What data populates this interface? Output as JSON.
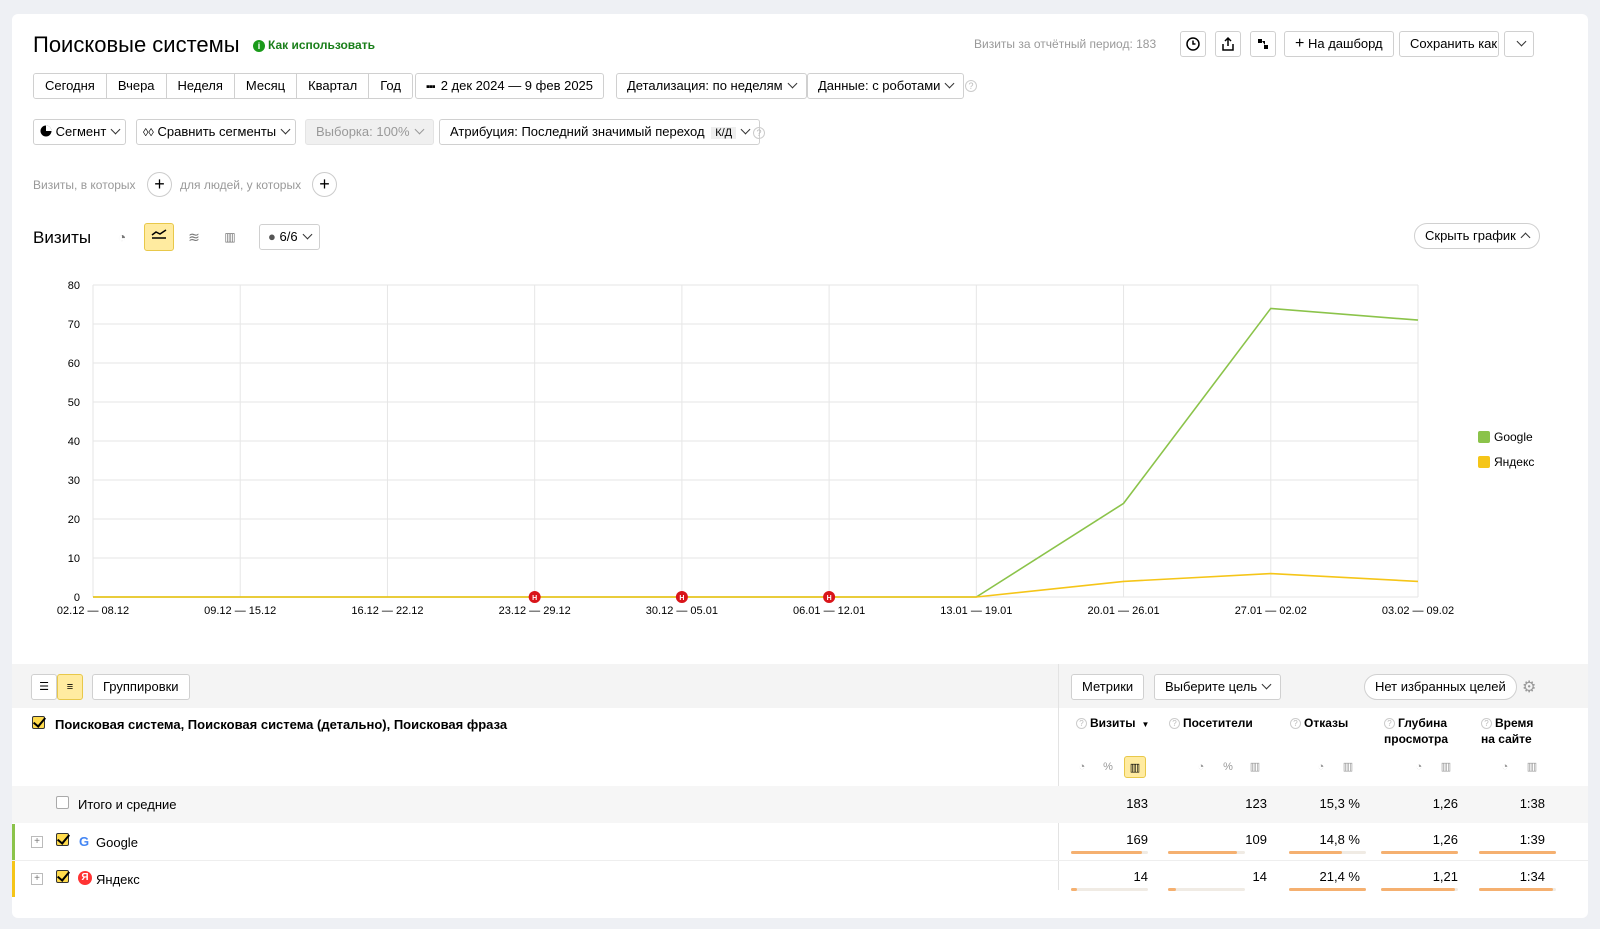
{
  "header": {
    "title": "Поисковые системы",
    "how_to_use": "Как использовать",
    "visits_period": "Визиты за отчётный период: 183",
    "to_dashboard": "На дашборд",
    "save_as": "Сохранить как"
  },
  "period": {
    "presets": [
      "Сегодня",
      "Вчера",
      "Неделя",
      "Месяц",
      "Квартал",
      "Год"
    ],
    "date_range": "2 дек 2024 — 9 фев 2025",
    "detail": "Детализация: по неделям",
    "data": "Данные: с роботами"
  },
  "filters": {
    "segment": "Сегмент",
    "compare": "Сравнить сегменты",
    "sample": "Выборка: 100%",
    "attribution": "Атрибуция: Последний значимый переход",
    "attribution_badge": "К/Д",
    "visits_where": "Визиты, в которых",
    "people_where": "для людей, у которых"
  },
  "chart_panel": {
    "title": "Визиты",
    "series_count": "6/6",
    "hide_chart": "Скрыть график"
  },
  "chart_data": {
    "type": "line",
    "categories": [
      "02.12 — 08.12",
      "09.12 — 15.12",
      "16.12 — 22.12",
      "23.12 — 29.12",
      "30.12 — 05.01",
      "06.01 — 12.01",
      "13.01 — 19.01",
      "20.01 — 26.01",
      "27.01 — 02.02",
      "03.02 — 09.02"
    ],
    "y_ticks": [
      0,
      10,
      20,
      30,
      40,
      50,
      60,
      70,
      80
    ],
    "ylim": [
      0,
      80
    ],
    "series": [
      {
        "name": "Google",
        "color": "#8bc34a",
        "values": [
          0,
          0,
          0,
          0,
          0,
          0,
          0,
          24,
          74,
          71
        ]
      },
      {
        "name": "Яндекс",
        "color": "#f5c518",
        "values": [
          0,
          0,
          0,
          0,
          0,
          0,
          0,
          4,
          6,
          4
        ]
      }
    ],
    "markers": [
      3,
      4,
      5
    ],
    "marker_label": "Н",
    "legend": "right",
    "grid": true
  },
  "table": {
    "groupings": "Группировки",
    "metrics": "Метрики",
    "choose_goal": "Выберите цель",
    "no_fav_goals": "Нет избранных целей",
    "dimension_header": "Поисковая система, Поисковая система (детально), Поисковая фраза",
    "columns": [
      "Визиты",
      "Посетители",
      "Отказы",
      "Глубина просмотра",
      "Время на сайте"
    ],
    "col_lines": [
      [
        "Визиты"
      ],
      [
        "Посетители"
      ],
      [
        "Отказы"
      ],
      [
        "Глубина",
        "просмотра"
      ],
      [
        "Время",
        "на сайте"
      ]
    ],
    "totals_label": "Итого и средние",
    "totals": [
      "183",
      "123",
      "15,3 %",
      "1,26",
      "1:38"
    ],
    "rows": [
      {
        "name": "Google",
        "icon": "G",
        "values": [
          "169",
          "109",
          "14,8 %",
          "1,26",
          "1:39"
        ],
        "bars": [
          0.92,
          0.89,
          0.69,
          1.0,
          1.0
        ]
      },
      {
        "name": "Яндекс",
        "icon": "Я",
        "values": [
          "14",
          "14",
          "21,4 %",
          "1,21",
          "1:34"
        ],
        "bars": [
          0.08,
          0.11,
          1.0,
          0.96,
          0.96
        ]
      }
    ]
  }
}
